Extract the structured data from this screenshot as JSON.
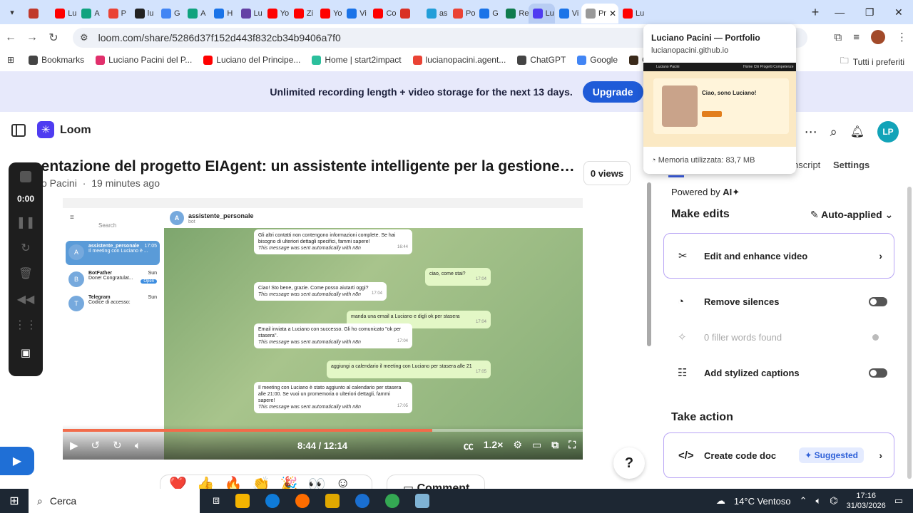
{
  "browser": {
    "tabs": [
      {
        "label": "",
        "color": "#c0392b"
      },
      {
        "label": "Lu",
        "color": "#ff0000"
      },
      {
        "label": "A",
        "color": "#10a37f"
      },
      {
        "label": "P",
        "color": "#ea4335"
      },
      {
        "label": "lu",
        "color": "#222222"
      },
      {
        "label": "G",
        "color": "#4285f4"
      },
      {
        "label": "A",
        "color": "#10a37f"
      },
      {
        "label": "H",
        "color": "#1a73e8"
      },
      {
        "label": "Lu",
        "color": "#6441a5"
      },
      {
        "label": "Yo",
        "color": "#ff0000"
      },
      {
        "label": "Zi",
        "color": "#ff0000"
      },
      {
        "label": "Yo",
        "color": "#ff0000"
      },
      {
        "label": "Vi",
        "color": "#1a73e8"
      },
      {
        "label": "Co",
        "color": "#ff0000"
      },
      {
        "label": "",
        "color": "#d93025"
      },
      {
        "label": "as",
        "color": "#229ed9"
      },
      {
        "label": "Po",
        "color": "#ea4335"
      },
      {
        "label": "G",
        "color": "#1a73e8"
      },
      {
        "label": "Re",
        "color": "#0f7b4d"
      },
      {
        "label": "Lu",
        "color": "#4f3cf1"
      },
      {
        "label": "Vi",
        "color": "#1a73e8"
      },
      {
        "label": "Pr",
        "color": "#999999"
      },
      {
        "label": "Lu",
        "color": "#ff0000"
      }
    ],
    "url": "loom.com/share/5286d37f152d443f832cb34b9406a7f0",
    "bookmarks": [
      {
        "label": "Bookmarks",
        "color": "#444444"
      },
      {
        "label": "Luciano Pacini del P...",
        "color": "#e1306c"
      },
      {
        "label": "Luciano del Principe...",
        "color": "#ff0000"
      },
      {
        "label": "Home | start2impact",
        "color": "#2bbf9c"
      },
      {
        "label": "lucianopacini.agent...",
        "color": "#ea4335"
      },
      {
        "label": "ChatGPT",
        "color": "#444444"
      },
      {
        "label": "Google",
        "color": "#4285f4"
      },
      {
        "label": "Custom Jackets | De...",
        "color": "#3a2a1a"
      }
    ],
    "bookmarks_right": "Tutti i preferiti"
  },
  "hover_card": {
    "title": "Luciano Pacini — Portfolio",
    "url": "lucianopacini.github.io",
    "nav_text": "Home  Chi  Progetti  Competenze",
    "logo_text": "Luciano Pacini",
    "hello": "Ciao, sono Luciano!",
    "memory": "Memoria utilizzata: 83,7 MB"
  },
  "banner": {
    "text": "Unlimited recording length + video storage for the next 13 days.",
    "upgrade_label": "Upgrade"
  },
  "loom": {
    "name": "Loom",
    "user_initials": "LP"
  },
  "video": {
    "title": "sentazione del progetto EIAgent: un assistente intelligente per la gestione delle ...",
    "author": "o Pacini",
    "time_ago": "19 minutes ago",
    "views": "0 views",
    "elapsed": "8:44 / 12:14",
    "speed": "1.2×",
    "progress": 0.71
  },
  "recorder": {
    "time": "0:00"
  },
  "inner_app": {
    "search": "Search",
    "chat_title": "assistente_personale",
    "chat_sub": "bot",
    "chats": [
      {
        "name": "assistente_personale",
        "preview": "Il meeting con Luciano è ...",
        "time": "17:05"
      },
      {
        "name": "BotFather",
        "preview": "Done! Congratulat...",
        "time": "Sun"
      },
      {
        "name": "Telegram",
        "preview": "Codice di accesso:",
        "time": "Sun"
      }
    ],
    "open_badge": "Open",
    "messages": [
      {
        "text": "Gli altri contatti non contengono informazioni complete. Se hai bisogno di ulteriori dettagli specifici, fammi sapere!",
        "note": "This message was sent automatically with n8n",
        "time": "16:44",
        "out": false
      },
      {
        "text": "ciao, come stai?",
        "note": "",
        "time": "17:04",
        "out": true
      },
      {
        "text": "Ciao! Sto bene, grazie. Come posso aiutarti oggi?",
        "note": "This message was sent automatically with n8n",
        "time": "17:04",
        "out": false
      },
      {
        "text": "manda una email a Luciano e digli ok per stasera",
        "note": "",
        "time": "17:04",
        "out": true
      },
      {
        "text": "Email inviata a Luciano con successo. Gli ho comunicato \"ok per stasera\".",
        "note": "This message was sent automatically with n8n",
        "time": "17:04",
        "out": false
      },
      {
        "text": "aggiungi a calendario il meeting con Luciano per stasera alle 21",
        "note": "",
        "time": "17:05",
        "out": true
      },
      {
        "text": "Il meeting con Luciano è stato aggiunto al calendario per stasera alle 21:00. Se vuoi un promemoria o ulteriori dettagli, fammi sapere!",
        "note": "This message was sent automatically with n8n",
        "time": "17:05",
        "out": false
      }
    ]
  },
  "panel": {
    "tab_transcript": "nscript",
    "tab_settings": "Settings",
    "powered_by": "Powered by",
    "ai": "AI",
    "make_edits": "Make edits",
    "auto_applied": "Auto-applied",
    "edit_enhance": "Edit and enhance video",
    "remove_silences": "Remove silences",
    "filler_words": "0 filler words found",
    "captions": "Add stylized captions",
    "take_action": "Take action",
    "code_doc": "Create code doc",
    "suggested": "Suggested"
  },
  "comment_label": "Comment",
  "taskbar": {
    "search": "Cerca",
    "weather": "14°C Ventoso",
    "time": "17:16",
    "date": "31/03/2026"
  }
}
